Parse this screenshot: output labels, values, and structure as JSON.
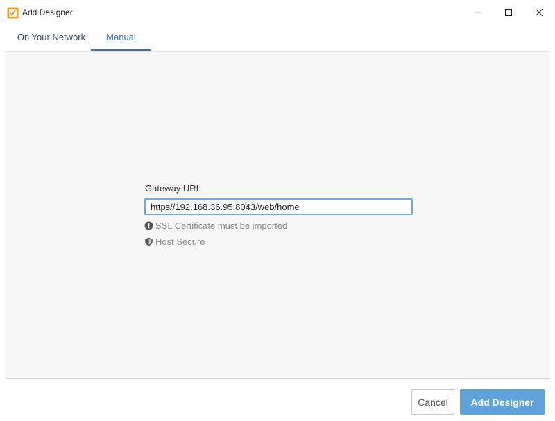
{
  "window": {
    "title": "Add Designer",
    "icons": {
      "app": "designer-app-icon",
      "minimize": "minimize-icon",
      "maximize": "maximize-icon",
      "close": "close-icon"
    }
  },
  "tabs": [
    {
      "label": "On Your Network",
      "active": false
    },
    {
      "label": "Manual",
      "active": true
    }
  ],
  "form": {
    "gateway_label": "Gateway URL",
    "gateway_value": "https//192.168.36.95:8043/web/home"
  },
  "status": {
    "ssl": {
      "icon": "exclamation-circle-icon",
      "text": "SSL Certificate must be imported"
    },
    "host": {
      "icon": "shield-icon",
      "text": "Host Secure"
    }
  },
  "footer": {
    "cancel_label": "Cancel",
    "add_label": "Add Designer"
  },
  "colors": {
    "accent": "#2f73b3",
    "primary_button": "#5ea3de",
    "input_focus": "#6ea8dc",
    "app_icon": "#f29c1f",
    "status_text": "#8a8a8a",
    "panel_bg": "#f7f7f7"
  }
}
